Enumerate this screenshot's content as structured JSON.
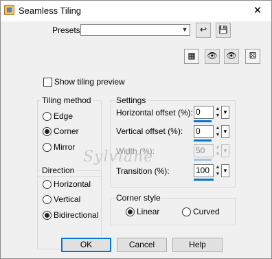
{
  "window": {
    "title": "Seamless Tiling",
    "close_glyph": "✕"
  },
  "presets": {
    "label": "Presets:",
    "value": ""
  },
  "toolbar": {
    "reset_glyph": "↩",
    "save_glyph": "💾",
    "layout_glyph": "▦",
    "eye_glyph": "👁",
    "eye2_glyph": "👁",
    "random_glyph": "⚄"
  },
  "preview": {
    "label": "Show tiling preview",
    "checked": false
  },
  "tiling_method": {
    "title": "Tiling method",
    "options": [
      "Edge",
      "Corner",
      "Mirror"
    ],
    "selected": "Corner"
  },
  "direction": {
    "title": "Direction",
    "options": [
      "Horizontal",
      "Vertical",
      "Bidirectional"
    ],
    "selected": "Bidirectional"
  },
  "settings": {
    "title": "Settings",
    "horizontal_offset": {
      "label": "Horizontal offset (%):",
      "value": "0"
    },
    "vertical_offset": {
      "label": "Vertical offset (%):",
      "value": "0"
    },
    "width": {
      "label": "Width (%):",
      "value": "50",
      "enabled": false
    },
    "transition": {
      "label": "Transition (%):",
      "value": "100"
    }
  },
  "corner_style": {
    "title": "Corner style",
    "options": [
      "Linear",
      "Curved"
    ],
    "selected": "Linear"
  },
  "buttons": {
    "ok": "OK",
    "cancel": "Cancel",
    "help": "Help"
  },
  "watermark": "Sylviane",
  "colors": {
    "accent": "#0078d7",
    "window_bg": "#f0f0f0",
    "title_bg": "#ffffff"
  }
}
